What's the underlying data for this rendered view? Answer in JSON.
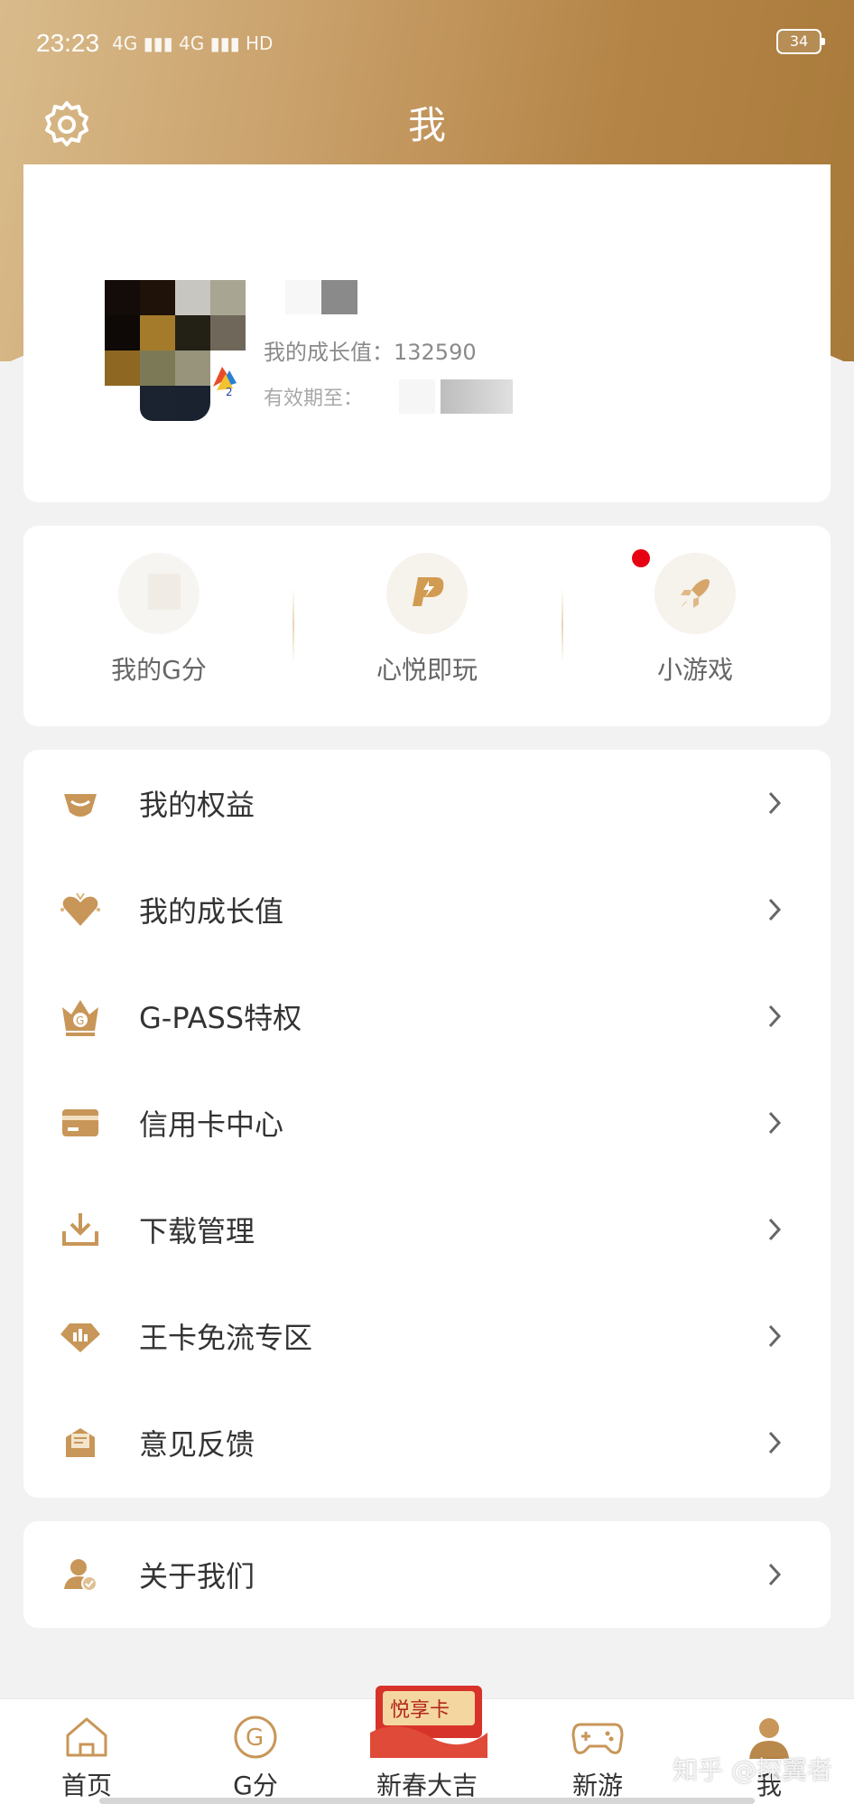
{
  "status_bar": {
    "time": "23:23",
    "signal_text": "4G ▮▮▮ 4G ▮▮▮ HD",
    "battery": "34"
  },
  "header": {
    "title": "我",
    "settings_icon": "gear-icon"
  },
  "profile": {
    "growth_label": "我的成长值：132590",
    "expire_label": "有效期至："
  },
  "quick_actions": [
    {
      "label": "我的G分",
      "icon": "g-points-icon"
    },
    {
      "label": "心悦即玩",
      "icon": "instant-play-icon"
    },
    {
      "label": "小游戏",
      "icon": "rocket-icon",
      "has_red_dot": true
    }
  ],
  "menu": [
    {
      "label": "我的权益",
      "icon": "benefits-icon"
    },
    {
      "label": "我的成长值",
      "icon": "growth-heart-icon"
    },
    {
      "label": "G-PASS特权",
      "icon": "crown-icon"
    },
    {
      "label": "信用卡中心",
      "icon": "credit-card-icon"
    },
    {
      "label": "下载管理",
      "icon": "download-icon"
    },
    {
      "label": "王卡免流专区",
      "icon": "king-card-icon"
    },
    {
      "label": "意见反馈",
      "icon": "feedback-icon"
    }
  ],
  "about": {
    "label": "关于我们",
    "icon": "about-us-icon"
  },
  "tabbar": {
    "tabs": [
      {
        "label": "首页",
        "icon": "home-icon"
      },
      {
        "label": "G分",
        "icon": "g-points-icon"
      },
      {
        "label": "新春大吉",
        "icon": "promo-icon"
      },
      {
        "label": "新游",
        "icon": "gamepad-icon"
      },
      {
        "label": "我",
        "icon": "user-icon"
      }
    ],
    "promo_badge": "悦享卡"
  },
  "watermark": "知乎 @探翼者",
  "colors": {
    "accent_gold": "#c69a5c",
    "hero_gradient_start": "#d9bb8b",
    "hero_gradient_end": "#a87a3a",
    "red_dot": "#e60012",
    "page_bg": "#f2f2f2"
  }
}
